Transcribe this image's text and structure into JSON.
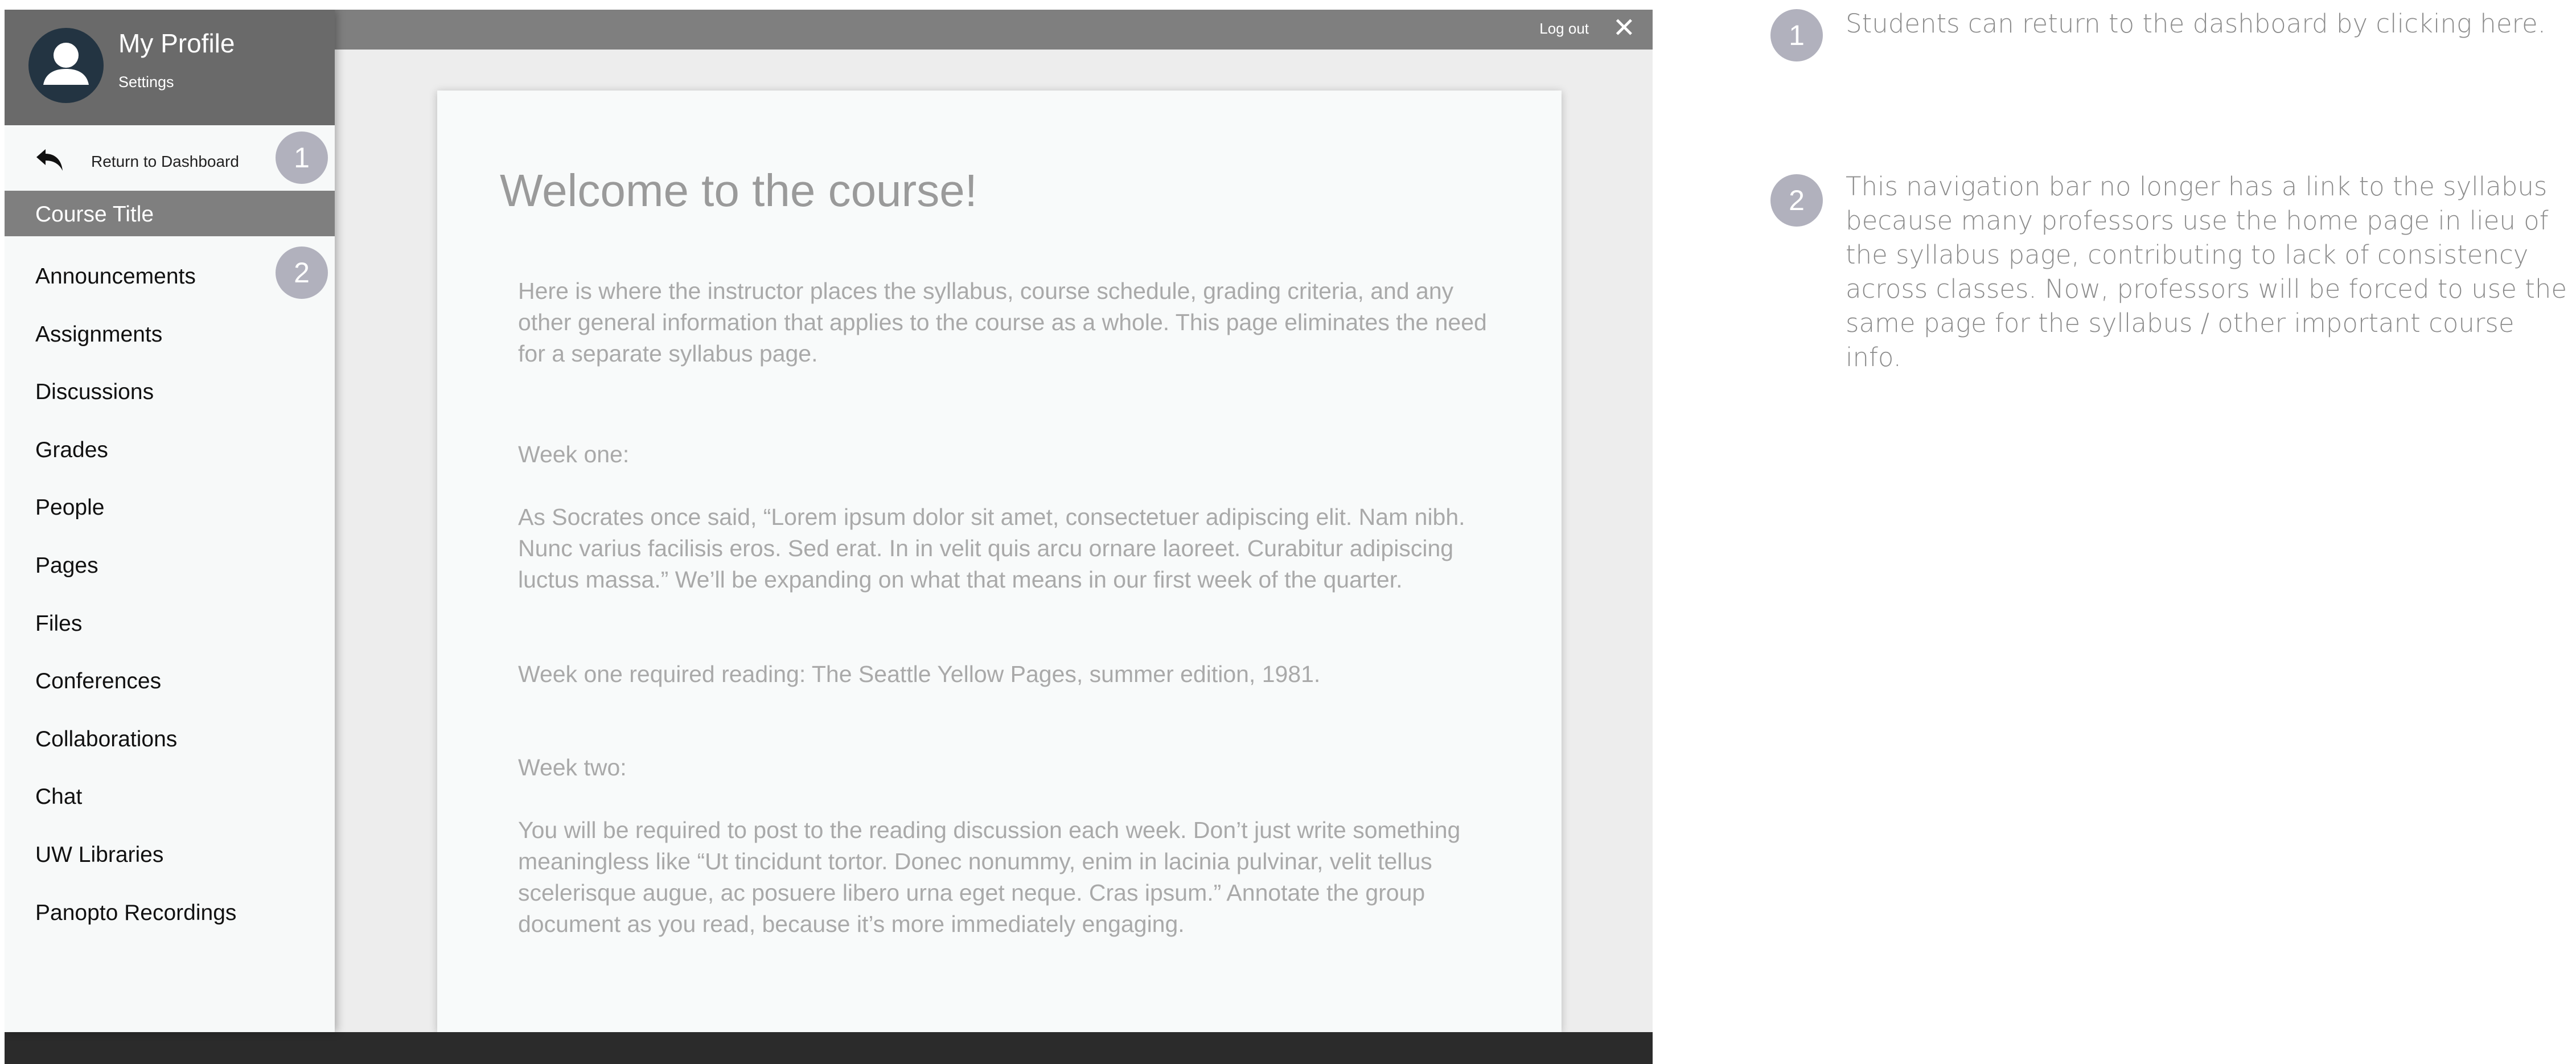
{
  "topbar": {
    "logout_label": "Log out",
    "close_symbol": "✕"
  },
  "sidebar": {
    "profile": {
      "name": "My Profile",
      "settings_label": "Settings"
    },
    "return_label": "Return to Dashboard",
    "course_title": "Course Title",
    "nav_items": [
      "Announcements",
      "Assignments",
      "Discussions",
      "Grades",
      "People",
      "Pages",
      "Files",
      "Conferences",
      "Collaborations",
      "Chat",
      "UW Libraries",
      "Panopto Recordings"
    ]
  },
  "content": {
    "title": "Welcome to the course!",
    "intro": "Here is where the instructor places the syllabus, course schedule, grading criteria, and any other general information that applies to the course as a whole. This page eliminates the need for a separate syllabus page.",
    "week_one_heading": "Week one:",
    "week_one_text": "As Socrates once said, “Lorem ipsum dolor sit amet, consectetuer adipiscing elit. Nam nibh. Nunc varius facilisis eros. Sed erat. In in velit quis arcu ornare laoreet. Curabitur adipiscing luctus massa.” We’ll be expanding on what that means in our first week of the quarter.",
    "week_one_reading": "Week one required reading: The Seattle Yellow Pages, summer edition, 1981.",
    "week_two_heading": "Week two:",
    "week_two_text": "You will be required to post to the reading discussion each week. Don’t just write something meaningless like “Ut tincidunt tortor. Donec nonummy, enim in lacinia pulvinar, velit tellus scelerisque augue, ac posuere libero urna eget neque. Cras ipsum.” Annotate the group document as you read, because it’s more immediately engaging."
  },
  "markers": {
    "one": "1",
    "two": "2"
  },
  "annotations": {
    "one": "Students can return to the dashboard by clicking here.",
    "two": "This navigation bar no longer has a link to the syllabus because many professors use the home page in lieu of the syllabus page, contributing to lack of consistency across classes. Now, professors will be forced to use the same page for the syllabus / other important course info."
  },
  "colors": {
    "topbar": "#7f7f7f",
    "profile_header": "#6a6a6a",
    "course_title_bar": "#7f7f7f",
    "marker": "#b1b1bd",
    "bottombar": "#2b2b2b"
  },
  "icons": {
    "avatar": "user-avatar-icon",
    "return": "reply-arrow-icon",
    "close": "close-icon"
  }
}
